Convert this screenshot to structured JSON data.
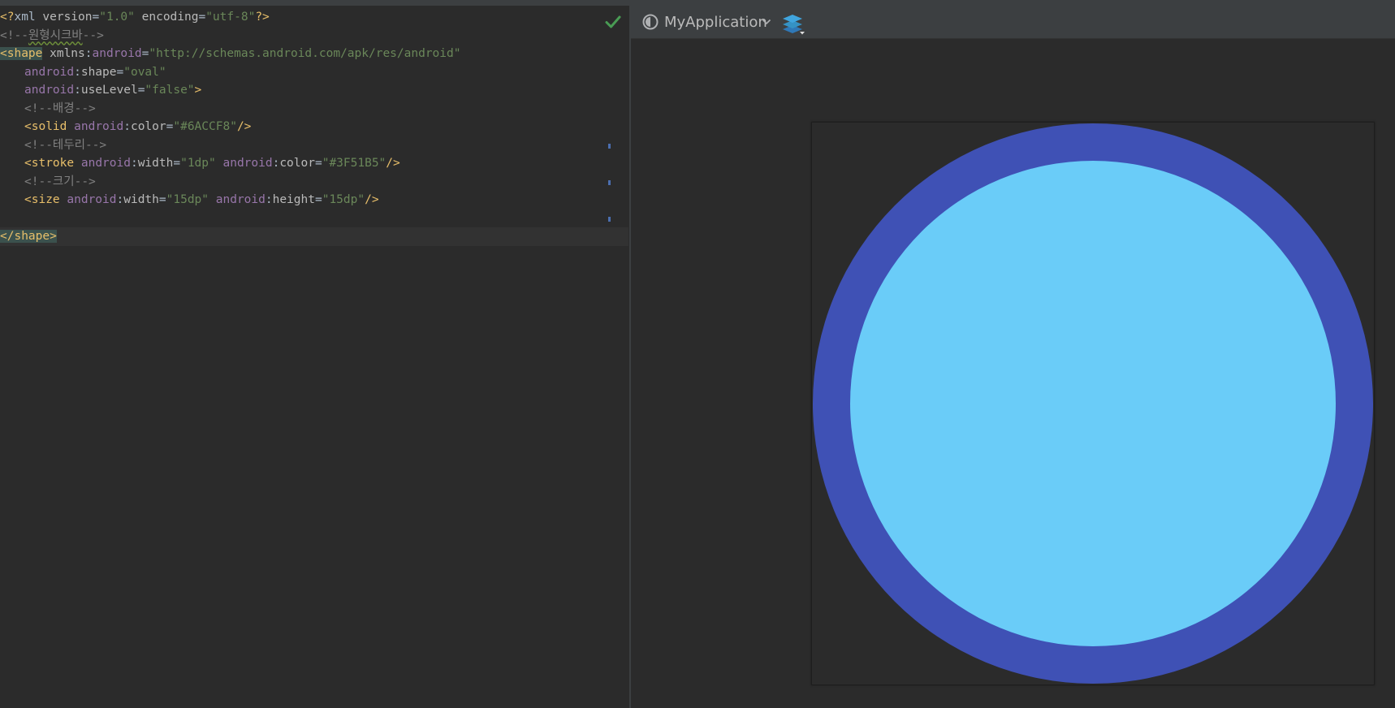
{
  "editor": {
    "lines": [
      {
        "tokens": [
          {
            "t": "<?",
            "c": "tk-br"
          },
          {
            "t": "xml ",
            "c": "tk-plain"
          },
          {
            "t": "version",
            "c": "tk-attr"
          },
          {
            "t": "=",
            "c": "tk-plain"
          },
          {
            "t": "\"1.0\"",
            "c": "tk-val"
          },
          {
            "t": " ",
            "c": "tk-plain"
          },
          {
            "t": "encoding",
            "c": "tk-attr"
          },
          {
            "t": "=",
            "c": "tk-plain"
          },
          {
            "t": "\"utf-8\"",
            "c": "tk-val"
          },
          {
            "t": "?>",
            "c": "tk-br"
          }
        ]
      },
      {
        "tokens": [
          {
            "t": "<!--",
            "c": "tk-com"
          },
          {
            "t": "원형시크바",
            "c": "tk-com tk-err"
          },
          {
            "t": "-->",
            "c": "tk-com"
          }
        ]
      },
      {
        "tokens": [
          {
            "t": "<",
            "c": "tk-br tk-hl"
          },
          {
            "t": "shape",
            "c": "tk-tag tk-hl"
          },
          {
            "t": " xmlns",
            "c": "tk-attr"
          },
          {
            "t": ":",
            "c": "tk-plain"
          },
          {
            "t": "android",
            "c": "tk-ns"
          },
          {
            "t": "=",
            "c": "tk-plain"
          },
          {
            "t": "\"http://schemas.android.com/apk/res/android\"",
            "c": "tk-val"
          }
        ]
      },
      {
        "indent": 1,
        "tokens": [
          {
            "t": "android",
            "c": "tk-ns"
          },
          {
            "t": ":",
            "c": "tk-plain"
          },
          {
            "t": "shape",
            "c": "tk-attr"
          },
          {
            "t": "=",
            "c": "tk-plain"
          },
          {
            "t": "\"oval\"",
            "c": "tk-val"
          }
        ]
      },
      {
        "indent": 1,
        "tokens": [
          {
            "t": "android",
            "c": "tk-ns"
          },
          {
            "t": ":",
            "c": "tk-plain"
          },
          {
            "t": "useLevel",
            "c": "tk-attr"
          },
          {
            "t": "=",
            "c": "tk-plain"
          },
          {
            "t": "\"false\"",
            "c": "tk-val"
          },
          {
            "t": ">",
            "c": "tk-br"
          }
        ]
      },
      {
        "indent": 1,
        "tokens": [
          {
            "t": "<!--배경-->",
            "c": "tk-com"
          }
        ]
      },
      {
        "indent": 1,
        "tokens": [
          {
            "t": "<",
            "c": "tk-br"
          },
          {
            "t": "solid",
            "c": "tk-tag"
          },
          {
            "t": " ",
            "c": "tk-plain"
          },
          {
            "t": "android",
            "c": "tk-ns"
          },
          {
            "t": ":",
            "c": "tk-plain"
          },
          {
            "t": "color",
            "c": "tk-attr"
          },
          {
            "t": "=",
            "c": "tk-plain"
          },
          {
            "t": "\"#6ACCF8\"",
            "c": "tk-val"
          },
          {
            "t": "/>",
            "c": "tk-br"
          }
        ]
      },
      {
        "indent": 1,
        "tokens": [
          {
            "t": "<!--테두리-->",
            "c": "tk-com"
          }
        ]
      },
      {
        "indent": 1,
        "tokens": [
          {
            "t": "<",
            "c": "tk-br"
          },
          {
            "t": "stroke",
            "c": "tk-tag"
          },
          {
            "t": " ",
            "c": "tk-plain"
          },
          {
            "t": "android",
            "c": "tk-ns"
          },
          {
            "t": ":",
            "c": "tk-plain"
          },
          {
            "t": "width",
            "c": "tk-attr"
          },
          {
            "t": "=",
            "c": "tk-plain"
          },
          {
            "t": "\"1dp\"",
            "c": "tk-val"
          },
          {
            "t": " ",
            "c": "tk-plain"
          },
          {
            "t": "android",
            "c": "tk-ns"
          },
          {
            "t": ":",
            "c": "tk-plain"
          },
          {
            "t": "color",
            "c": "tk-attr"
          },
          {
            "t": "=",
            "c": "tk-plain"
          },
          {
            "t": "\"#3F51B5\"",
            "c": "tk-val"
          },
          {
            "t": "/>",
            "c": "tk-br"
          }
        ]
      },
      {
        "indent": 1,
        "tokens": [
          {
            "t": "<!--크기-->",
            "c": "tk-com"
          }
        ]
      },
      {
        "indent": 1,
        "tokens": [
          {
            "t": "<",
            "c": "tk-br"
          },
          {
            "t": "size",
            "c": "tk-tag"
          },
          {
            "t": " ",
            "c": "tk-plain"
          },
          {
            "t": "android",
            "c": "tk-ns"
          },
          {
            "t": ":",
            "c": "tk-plain"
          },
          {
            "t": "width",
            "c": "tk-attr"
          },
          {
            "t": "=",
            "c": "tk-plain"
          },
          {
            "t": "\"15dp\"",
            "c": "tk-val"
          },
          {
            "t": " ",
            "c": "tk-plain"
          },
          {
            "t": "android",
            "c": "tk-ns"
          },
          {
            "t": ":",
            "c": "tk-plain"
          },
          {
            "t": "height",
            "c": "tk-attr"
          },
          {
            "t": "=",
            "c": "tk-plain"
          },
          {
            "t": "\"15dp\"",
            "c": "tk-val"
          },
          {
            "t": "/>",
            "c": "tk-br"
          }
        ]
      },
      {
        "tokens": []
      },
      {
        "caret": true,
        "tokens": [
          {
            "t": "</",
            "c": "tk-br tk-hl"
          },
          {
            "t": "shape",
            "c": "tk-tag tk-hl"
          },
          {
            "t": ">",
            "c": "tk-br tk-hl"
          }
        ]
      }
    ]
  },
  "preview": {
    "app_name": "MyApplication",
    "icons": {
      "theme": "theme-icon",
      "dropdown": "chevron-down-icon",
      "layers": "layers-icon",
      "status": "check-icon"
    },
    "shape": {
      "fill_color": "#6ACCF8",
      "stroke_color": "#3F51B5"
    }
  }
}
